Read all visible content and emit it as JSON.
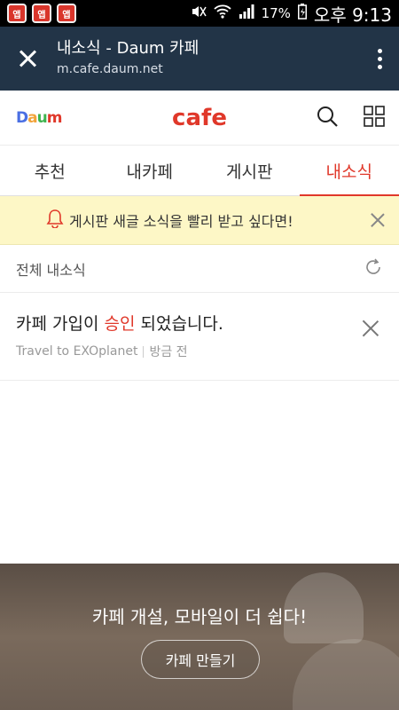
{
  "status_bar": {
    "notifications": [
      "앱",
      "앱",
      "앱"
    ],
    "battery": "17%",
    "time": "오후 9:13",
    "icons": [
      "mute-icon",
      "wifi-icon",
      "signal-icon",
      "battery-icon"
    ]
  },
  "titlebar": {
    "title": "내소식 - Daum 카페",
    "url": "m.cafe.daum.net"
  },
  "header": {
    "daum_logo": "Daum",
    "cafe_logo": "cafe",
    "icons": [
      "search-icon",
      "grid-menu-icon"
    ]
  },
  "tabs": [
    {
      "label": "추천"
    },
    {
      "label": "내카페"
    },
    {
      "label": "게시판"
    },
    {
      "label": "내소식"
    }
  ],
  "banner": {
    "text": "게시판 새글 소식을 빨리 받고 싶다면!"
  },
  "section": {
    "title": "전체 내소식"
  },
  "notice": {
    "title_prefix": "카페 가입이 ",
    "title_highlight": "승인",
    "title_suffix": " 되었습니다.",
    "cafe_name": "Travel to EXOplanet",
    "time": "방금 전"
  },
  "promo": {
    "text": "카페 개설, 모바일이 더 쉽다!",
    "button": "카페 만들기"
  },
  "colors": {
    "accent": "#e0382a",
    "titlebar": "#223447",
    "banner": "#fdf7c6"
  }
}
